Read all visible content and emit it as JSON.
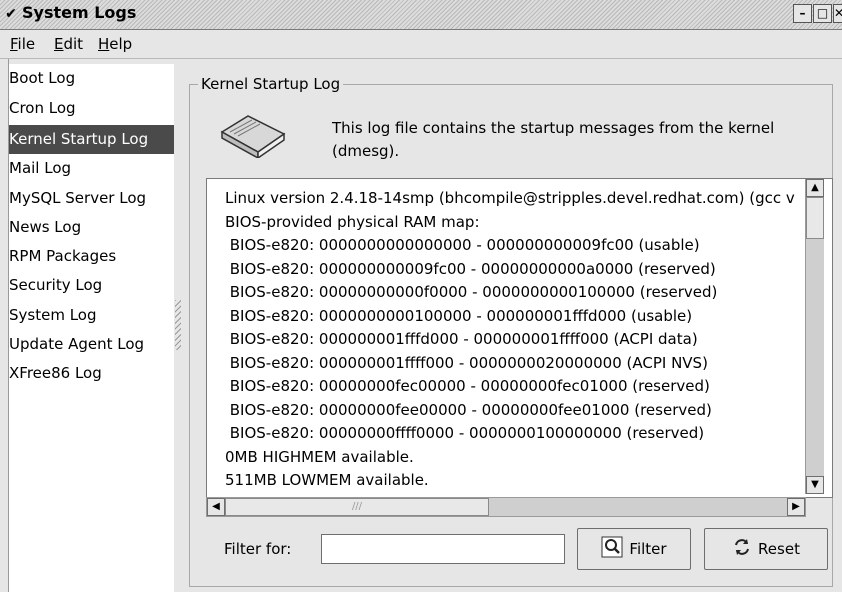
{
  "window": {
    "title": "System Logs"
  },
  "menubar": {
    "file": {
      "underline": "F",
      "rest": "ile"
    },
    "edit": {
      "underline": "E",
      "rest": "dit"
    },
    "help": {
      "underline": "H",
      "rest": "elp"
    }
  },
  "sidebar": {
    "items": [
      {
        "label": "Boot Log"
      },
      {
        "label": "Cron Log"
      },
      {
        "label": "Kernel Startup Log"
      },
      {
        "label": "Mail Log"
      },
      {
        "label": "MySQL Server Log"
      },
      {
        "label": "News Log"
      },
      {
        "label": "RPM Packages"
      },
      {
        "label": "Security Log"
      },
      {
        "label": "System Log"
      },
      {
        "label": "Update Agent Log"
      },
      {
        "label": "XFree86 Log"
      }
    ],
    "selected": "Kernel Startup Log"
  },
  "main": {
    "frame_title": "Kernel Startup Log",
    "description": "This log file contains the startup messages from the kernel",
    "description2": "(dmesg).",
    "log_lines": [
      "Linux version 2.4.18-14smp (bhcompile@stripples.devel.redhat.com) (gcc v",
      "BIOS-provided physical RAM map:",
      " BIOS-e820: 0000000000000000 - 000000000009fc00 (usable)",
      " BIOS-e820: 000000000009fc00 - 00000000000a0000 (reserved)",
      " BIOS-e820: 00000000000f0000 - 0000000000100000 (reserved)",
      " BIOS-e820: 0000000000100000 - 000000001fffd000 (usable)",
      " BIOS-e820: 000000001fffd000 - 000000001ffff000 (ACPI data)",
      " BIOS-e820: 000000001ffff000 - 0000000020000000 (ACPI NVS)",
      " BIOS-e820: 00000000fec00000 - 00000000fec01000 (reserved)",
      " BIOS-e820: 00000000fee00000 - 00000000fee01000 (reserved)",
      " BIOS-e820: 00000000ffff0000 - 0000000100000000 (reserved)",
      "0MB HIGHMEM available.",
      "511MB LOWMEM available."
    ],
    "filter_label": "Filter for:",
    "filter_value": "",
    "filter_button": "Filter",
    "reset_button": "Reset"
  },
  "icons": {
    "window_menu": "chevron-down-icon",
    "minimize": "minimize-icon",
    "maximize": "maximize-icon",
    "close": "close-icon",
    "book": "book-icon",
    "filter": "magnifier-icon",
    "reset": "refresh-icon"
  }
}
